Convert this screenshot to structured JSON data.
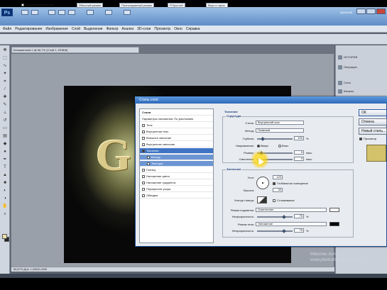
{
  "app": {
    "logo": "Ps",
    "workspace_label": "ВАЖНОЕ"
  },
  "menu": [
    "Файл",
    "Редактирование",
    "Изображение",
    "Слой",
    "Выделение",
    "Фильтр",
    "Анализ",
    "3D-слои",
    "Просмотр",
    "Окно",
    "Справка"
  ],
  "options": {
    "checkbox_label": "Вспомогательные вкл.",
    "buttons": [
      "Обычный режим",
      "Полноэкранный режим",
      "Р.Простой",
      "Верх и гориз."
    ]
  },
  "document": {
    "tab_title": "Безымянный-1 @ 66,7% (Слой 1, RGB/8)",
    "glyph": "G",
    "status": "66,67%   Док: 1,00М/1,00М"
  },
  "right_panel": {
    "items": [
      "ИСТОРИЯ",
      "Операции",
      "Слои",
      "Каналы",
      "Контуры",
      "Символ",
      "Абзац"
    ]
  },
  "dialog": {
    "title": "Стиль слоя",
    "list_header": "Стили",
    "list_items": [
      {
        "label": "Параметры наложения: По умолчанию",
        "checked": false,
        "state": "normal"
      },
      {
        "label": "Тень",
        "checked": false,
        "state": "normal"
      },
      {
        "label": "Внутренняя тень",
        "checked": false,
        "state": "normal"
      },
      {
        "label": "Внешнее свечение",
        "checked": false,
        "state": "normal"
      },
      {
        "label": "Внутреннее свечение",
        "checked": false,
        "state": "normal"
      },
      {
        "label": "Тиснение",
        "checked": true,
        "state": "selected"
      },
      {
        "label": "Контур",
        "checked": false,
        "state": "sub"
      },
      {
        "label": "Текстура",
        "checked": false,
        "state": "sub"
      },
      {
        "label": "Глянец",
        "checked": false,
        "state": "normal"
      },
      {
        "label": "Наложение цвета",
        "checked": false,
        "state": "normal"
      },
      {
        "label": "Наложение градиента",
        "checked": false,
        "state": "normal"
      },
      {
        "label": "Перекрытие узора",
        "checked": false,
        "state": "normal"
      },
      {
        "label": "Обводка",
        "checked": false,
        "state": "normal"
      }
    ],
    "section_title": "Тиснение",
    "structure": {
      "title": "Структура",
      "style_label": "Стиль:",
      "style_value": "Внутренний скос",
      "method_label": "Метод:",
      "method_value": "Плавный",
      "depth_label": "Глубина:",
      "depth_value": "100",
      "depth_unit": "%",
      "direction_label": "Направление:",
      "direction_up": "Вверх",
      "direction_down": "Вниз",
      "size_label": "Размер:",
      "size_value": "5",
      "size_unit": "пикс.",
      "soften_label": "Смягчение:",
      "soften_value": "0",
      "soften_unit": "пикс."
    },
    "shading": {
      "title": "Затенение",
      "angle_label": "Угол:",
      "angle_value": "120",
      "global_light": "Глобальное освещение",
      "altitude_label": "Высота:",
      "altitude_value": "30",
      "gloss_label": "Контур глянца:",
      "antialias": "Сглаживание",
      "highlight_label": "Режим подсветки:",
      "highlight_value": "Осветление",
      "opacity1_label": "Непрозрачность:",
      "opacity1_value": "75",
      "shadow_label": "Режим тени:",
      "shadow_value": "Умножение",
      "opacity2_label": "Непрозрачность:",
      "opacity2_value": "75",
      "percent": "%"
    },
    "buttons": {
      "ok": "ОК",
      "cancel": "Отмена",
      "new_style": "Новый стиль...",
      "preview": "Просмотр"
    }
  },
  "watermark": {
    "line1": "Мякотин Антон",
    "line2": "www.photoshop-video.com"
  }
}
